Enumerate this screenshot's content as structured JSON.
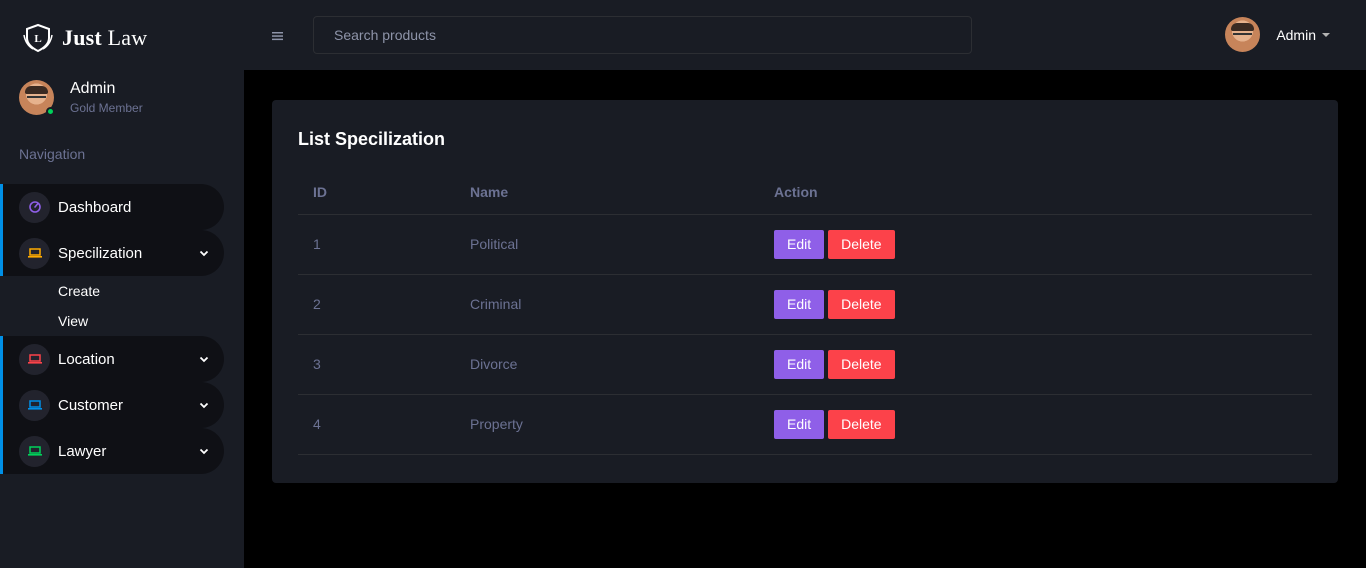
{
  "brand": {
    "name_bold": "Just",
    "name_light": "Law"
  },
  "sidebar": {
    "profile": {
      "name": "Admin",
      "role": "Gold Member"
    },
    "heading": "Navigation",
    "items": [
      {
        "label": "Dashboard",
        "icon": "speedometer-icon",
        "color": "#8f5fe8"
      },
      {
        "label": "Specilization",
        "icon": "laptop-icon",
        "color": "#ffab00",
        "submenu": [
          "Create",
          "View"
        ]
      },
      {
        "label": "Location",
        "icon": "laptop-icon",
        "color": "#fc424a"
      },
      {
        "label": "Customer",
        "icon": "laptop-icon",
        "color": "#0090e7"
      },
      {
        "label": "Lawyer",
        "icon": "laptop-icon",
        "color": "#00d25b"
      }
    ]
  },
  "topbar": {
    "search_placeholder": "Search products",
    "user_name": "Admin"
  },
  "main": {
    "title": "List Specilization",
    "columns": [
      "ID",
      "Name",
      "Action"
    ],
    "rows": [
      {
        "id": "1",
        "name": "Political"
      },
      {
        "id": "2",
        "name": "Criminal"
      },
      {
        "id": "3",
        "name": "Divorce"
      },
      {
        "id": "4",
        "name": "Property"
      }
    ],
    "edit_label": "Edit",
    "delete_label": "Delete"
  },
  "colors": {
    "accent": "#0090e7",
    "edit": "#8f5fe8",
    "delete": "#fc424a",
    "online": "#00d25b"
  }
}
